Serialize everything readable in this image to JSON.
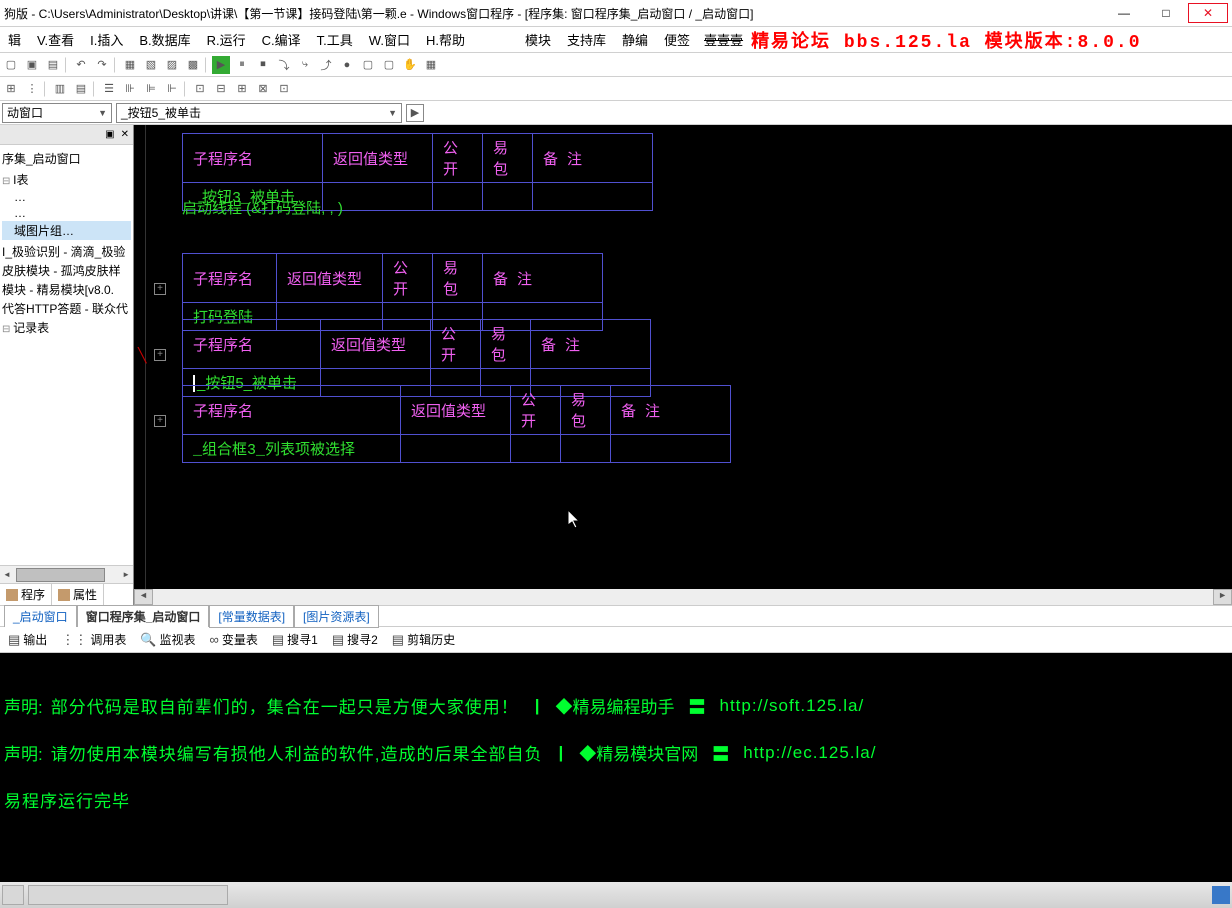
{
  "titlebar": {
    "text": "狗版 - C:\\Users\\Administrator\\Desktop\\讲课\\【第一节课】接码登陆\\第一颗.e - Windows窗口程序 - [程序集: 窗口程序集_启动窗口 / _启动窗口]"
  },
  "menu": {
    "items": [
      "辑",
      "V.查看",
      "I.插入",
      "B.数据库",
      "R.运行",
      "C.编译",
      "T.工具",
      "W.窗口",
      "H.帮助",
      "模块",
      "支持库",
      "静编",
      "便签"
    ],
    "banner": "精易论坛 bbs.125.la 模块版本:8.0.0"
  },
  "dropdowns": {
    "d1": "动窗口",
    "d2": "_按钮5_被单击"
  },
  "tree": {
    "items": [
      "序集_启动窗口",
      "",
      "I表",
      "…",
      "…",
      "域图片组…",
      "",
      "I_极验识别 - 滴滴_极验",
      "皮肤模块 - 孤鸿皮肤样",
      "模块 - 精易模块[v8.0.",
      "代答HTTP答题 - 联众代",
      "记录表"
    ],
    "sel_index": 5,
    "tabs": {
      "t1": "程序",
      "t2": "属性"
    }
  },
  "code": {
    "headers": [
      "子程序名",
      "返回值类型",
      "公开",
      "易包",
      "备 注"
    ],
    "sub1": {
      "name": "_按钮3_被单击"
    },
    "line1": "启动线程 (&打码登陆, , )",
    "sub2": {
      "name": "打码登陆"
    },
    "sub3": {
      "name": "_按钮5_被单击"
    },
    "sub4": {
      "name": "_组合框3_列表项被选择"
    }
  },
  "mid_tabs": {
    "t1": "_启动窗口",
    "t2": "窗口程序集_启动窗口",
    "t3": "[常量数据表]",
    "t4": "[图片资源表]"
  },
  "btool": {
    "t1": "输出",
    "t2": "调用表",
    "t3": "监视表",
    "t4": "变量表",
    "t5": "搜寻1",
    "t6": "搜寻2",
    "t7": "剪辑历史"
  },
  "output": {
    "line1": {
      "label": "声明:",
      "text": "部分代码是取自前辈们的，集合在一起只是方便大家使用！",
      "link_label": "◆精易编程助手",
      "url": "http://soft.125.la/"
    },
    "line2": {
      "label": "声明:",
      "text": "请勿使用本模块编写有损他人利益的软件,造成的后果全部自负",
      "link_label": "◆精易模块官网",
      "url": "http://ec.125.la/"
    },
    "line3": "易程序运行完毕"
  }
}
